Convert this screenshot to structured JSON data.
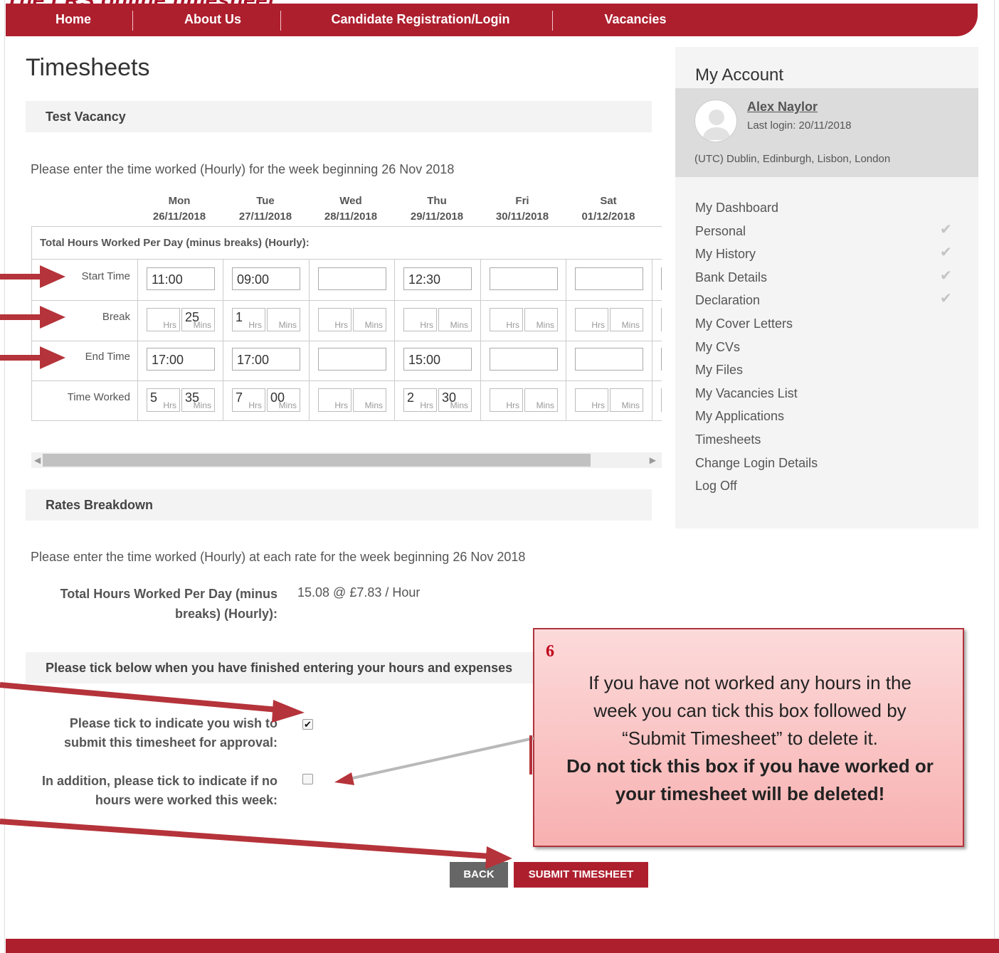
{
  "doc_title": "The LRS online timesheet.",
  "nav": {
    "home": "Home",
    "about": "About Us",
    "register": "Candidate Registration/Login",
    "vacancies": "Vacancies"
  },
  "page_title": "Timesheets",
  "vacancy_title": "Test Vacancy",
  "intro": "Please enter the time worked (Hourly) for the week beginning 26 Nov 2018",
  "days": [
    {
      "name": "Mon",
      "date": "26/11/2018"
    },
    {
      "name": "Tue",
      "date": "27/11/2018"
    },
    {
      "name": "Wed",
      "date": "28/11/2018"
    },
    {
      "name": "Thu",
      "date": "29/11/2018"
    },
    {
      "name": "Fri",
      "date": "30/11/2018"
    },
    {
      "name": "Sat",
      "date": "01/12/2018"
    }
  ],
  "grid": {
    "title": "Total Hours Worked Per Day (minus breaks) (Hourly):",
    "labels": {
      "start": "Start Time",
      "break": "Break",
      "end": "End Time",
      "worked": "Time Worked"
    },
    "unit_hrs": "Hrs",
    "unit_mins": "Mins",
    "start": [
      "11:00",
      "09:00",
      "",
      "12:30",
      "",
      ""
    ],
    "break_hrs": [
      "",
      "1",
      "",
      "",
      "",
      ""
    ],
    "break_mins": [
      "25",
      "",
      "",
      "",
      "",
      ""
    ],
    "end": [
      "17:00",
      "17:00",
      "",
      "15:00",
      "",
      ""
    ],
    "worked_hrs": [
      "5",
      "7",
      "",
      "2",
      "",
      ""
    ],
    "worked_mins": [
      "35",
      "00",
      "",
      "30",
      "",
      ""
    ]
  },
  "rates": {
    "title": "Rates Breakdown",
    "intro": "Please enter the time worked (Hourly) at each rate for the week beginning 26 Nov 2018",
    "label_line1": "Total Hours Worked Per Day (minus",
    "label_line2": "breaks) (Hourly):",
    "value": "15.08 @ £7.83 / Hour"
  },
  "confirm": {
    "title": "Please tick below when you have finished entering your hours and expenses",
    "submit_line1": "Please tick to indicate you wish to",
    "submit_line2": "submit this timesheet for approval:",
    "submit_checked": "✔",
    "nohours_line1": "In addition, please tick to indicate if no",
    "nohours_line2": "hours were worked this week:"
  },
  "buttons": {
    "back": "BACK",
    "submit": "SUBMIT TIMESHEET"
  },
  "sidebar": {
    "title": "My Account",
    "user_name": "Alex Naylor",
    "last_login": "Last login: 20/11/2018",
    "timezone": "(UTC) Dublin, Edinburgh, Lisbon, London",
    "items": [
      {
        "label": "My Dashboard",
        "check": ""
      },
      {
        "label": "Personal",
        "check": "✔"
      },
      {
        "label": "My History",
        "check": "✔"
      },
      {
        "label": "Bank Details",
        "check": "✔"
      },
      {
        "label": "Declaration",
        "check": "✔"
      },
      {
        "label": "My Cover Letters",
        "check": ""
      },
      {
        "label": "My CVs",
        "check": ""
      },
      {
        "label": "My Files",
        "check": ""
      },
      {
        "label": "My Vacancies List",
        "check": ""
      },
      {
        "label": "My Applications",
        "check": ""
      },
      {
        "label": "Timesheets",
        "check": ""
      },
      {
        "label": "Change Login Details",
        "check": ""
      },
      {
        "label": "Log Off",
        "check": ""
      }
    ]
  },
  "callout": {
    "number": "6",
    "line1": "If you have not worked any hours in the",
    "line2": "week you can tick this box followed by",
    "line3": "“Submit Timesheet” to delete it.",
    "bold1": "Do not tick this box if you have worked or",
    "bold2": "your timesheet will be deleted!"
  },
  "colors": {
    "brand": "#ae1f2e",
    "back_button": "#666666",
    "callout_border": "#b0343c",
    "arrow": "#b5333a"
  }
}
